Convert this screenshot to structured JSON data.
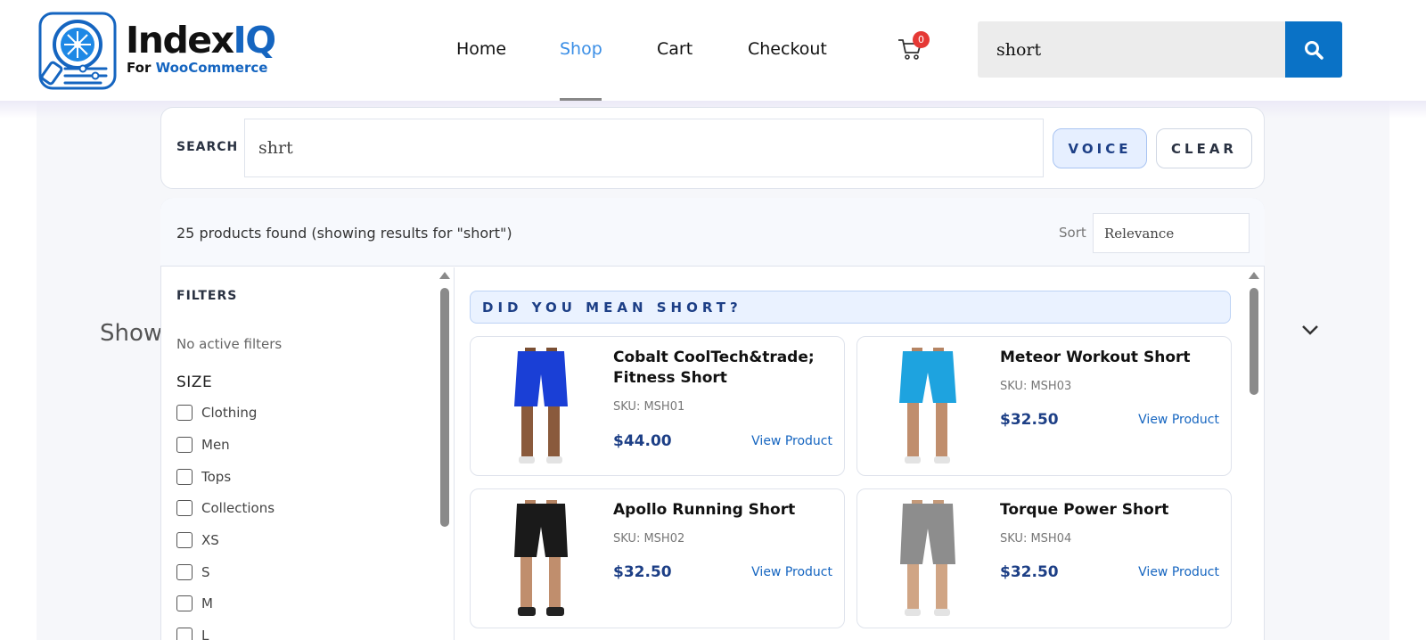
{
  "brand": {
    "name_part1": "Index",
    "name_part2": "IQ",
    "sub_part1": "For ",
    "sub_part2": "WooCommerce"
  },
  "nav": {
    "items": [
      "Home",
      "Shop",
      "Cart",
      "Checkout"
    ],
    "active": "Shop",
    "cart_count": "0"
  },
  "header_search": {
    "value": "short",
    "button_icon": "search-icon"
  },
  "background": {
    "show_text": "Show"
  },
  "search_panel": {
    "label": "SEARCH",
    "value": "shrt",
    "voice_label": "VOICE",
    "clear_label": "CLEAR"
  },
  "results": {
    "count_text": "25 products found (showing results for \"short\")",
    "sort_label": "Sort",
    "sort_value": "Relevance"
  },
  "filters": {
    "title": "FILTERS",
    "no_active": "No active filters",
    "group_title": "SIZE",
    "options": [
      "Clothing",
      "Men",
      "Tops",
      "Collections",
      "XS",
      "S",
      "M",
      "L"
    ]
  },
  "did_you_mean": "DID YOU MEAN SHORT?",
  "products": [
    {
      "name": "Cobalt CoolTech&trade; Fitness Short",
      "sku": "SKU: MSH01",
      "price": "$44.00",
      "link": "View Product",
      "color": "#1a3fd6"
    },
    {
      "name": "Meteor Workout Short",
      "sku": "SKU: MSH03",
      "price": "$32.50",
      "link": "View Product",
      "color": "#1ea3df"
    },
    {
      "name": "Apollo Running Short",
      "sku": "SKU: MSH02",
      "price": "$32.50",
      "link": "View Product",
      "color": "#1a1a1a"
    },
    {
      "name": "Torque Power Short",
      "sku": "SKU: MSH04",
      "price": "$32.50",
      "link": "View Product",
      "color": "#8d8d8d"
    }
  ],
  "colors": {
    "accent": "#0a72c6",
    "price": "#1d3f86",
    "link": "#1565c0",
    "badge": "#e53935"
  }
}
